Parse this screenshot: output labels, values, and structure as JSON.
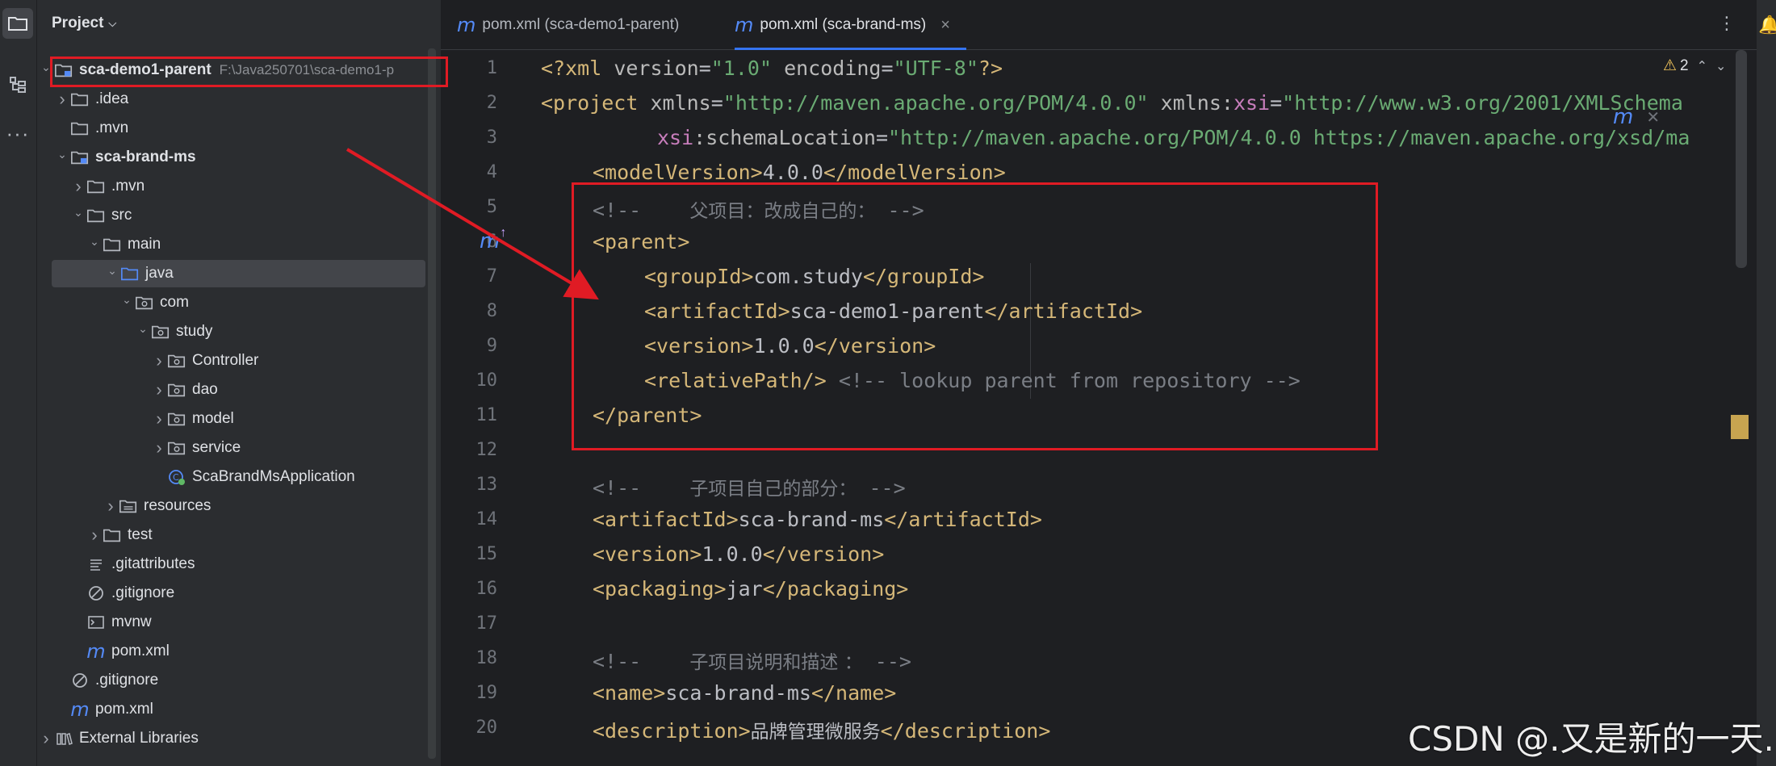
{
  "project_panel": {
    "title": "Project",
    "tree": [
      {
        "label": "sca-demo1-parent",
        "path": "F:\\Java250701\\sca-demo1-p",
        "icon": "module-folder-icon",
        "depth": 0,
        "chevron": "open",
        "bold": true
      },
      {
        "label": ".idea",
        "icon": "folder-icon",
        "depth": 1,
        "chevron": "closed"
      },
      {
        "label": ".mvn",
        "icon": "folder-icon",
        "depth": 1,
        "chevron": "none"
      },
      {
        "label": "sca-brand-ms",
        "icon": "module-folder-icon",
        "depth": 1,
        "chevron": "open",
        "bold": true
      },
      {
        "label": ".mvn",
        "icon": "folder-icon",
        "depth": 2,
        "chevron": "closed"
      },
      {
        "label": "src",
        "icon": "folder-icon",
        "depth": 2,
        "chevron": "open"
      },
      {
        "label": "main",
        "icon": "folder-icon",
        "depth": 3,
        "chevron": "open"
      },
      {
        "label": "java",
        "icon": "source-folder-icon",
        "depth": 4,
        "chevron": "open",
        "selected": true
      },
      {
        "label": "com",
        "icon": "package-icon",
        "depth": 5,
        "chevron": "open"
      },
      {
        "label": "study",
        "icon": "package-icon",
        "depth": 6,
        "chevron": "open"
      },
      {
        "label": "Controller",
        "icon": "package-icon",
        "depth": 7,
        "chevron": "closed"
      },
      {
        "label": "dao",
        "icon": "package-icon",
        "depth": 7,
        "chevron": "closed"
      },
      {
        "label": "model",
        "icon": "package-icon",
        "depth": 7,
        "chevron": "closed"
      },
      {
        "label": "service",
        "icon": "package-icon",
        "depth": 7,
        "chevron": "closed"
      },
      {
        "label": "ScaBrandMsApplication",
        "icon": "spring-class-icon",
        "depth": 7,
        "chevron": "none"
      },
      {
        "label": "resources",
        "icon": "resources-folder-icon",
        "depth": 4,
        "chevron": "closed"
      },
      {
        "label": "test",
        "icon": "folder-icon",
        "depth": 3,
        "chevron": "closed"
      },
      {
        "label": ".gitattributes",
        "icon": "text-file-icon",
        "depth": 2,
        "chevron": "none"
      },
      {
        "label": ".gitignore",
        "icon": "ignore-file-icon",
        "depth": 2,
        "chevron": "none"
      },
      {
        "label": "mvnw",
        "icon": "terminal-file-icon",
        "depth": 2,
        "chevron": "none"
      },
      {
        "label": "pom.xml",
        "icon": "maven-icon",
        "depth": 2,
        "chevron": "none"
      },
      {
        "label": ".gitignore",
        "icon": "ignore-file-icon",
        "depth": 1,
        "chevron": "none"
      },
      {
        "label": "pom.xml",
        "icon": "maven-icon",
        "depth": 1,
        "chevron": "none"
      },
      {
        "label": "External Libraries",
        "icon": "library-icon",
        "depth": 0,
        "chevron": "closed"
      }
    ]
  },
  "tabs": [
    {
      "label": "pom.xml (sca-demo1-parent)",
      "active": false
    },
    {
      "label": "pom.xml (sca-brand-ms)",
      "active": true,
      "close": "×"
    }
  ],
  "editor": {
    "warnings_count": "2",
    "line_numbers": [
      "1",
      "2",
      "3",
      "4",
      "5",
      "6",
      "7",
      "8",
      "9",
      "10",
      "11",
      "12",
      "13",
      "14",
      "15",
      "16",
      "17",
      "18",
      "19",
      "20"
    ],
    "lines": {
      "l1": {
        "open": "<?",
        "tag": "xml",
        "a1": " version",
        "eq1": "=",
        "s1": "\"1.0\"",
        "a2": " encoding",
        "eq2": "=",
        "s2": "\"UTF-8\"",
        "close": "?>"
      },
      "l2": {
        "tag": "<project",
        "a1": " xmlns",
        "eq1": "=",
        "s1": "\"http://maven.apache.org/POM/4.0.0\"",
        "a2": " xmlns:",
        "ns": "xsi",
        "eq2": "=",
        "s2": "\"http://www.w3.org/2001/XMLSchema"
      },
      "l3": {
        "ns": "xsi",
        "a": ":schemaLocation",
        "eq": "=",
        "s": "\"http://maven.apache.org/POM/4.0.0 https://maven.apache.org/xsd/ma"
      },
      "l4": {
        "open": "<modelVersion>",
        "value": "4.0.0",
        "close": "</modelVersion>"
      },
      "l5": {
        "c1": "<!--    ",
        "zh": "父项目：改成自己的：",
        "c2": " -->"
      },
      "l6": {
        "tag": "<parent>"
      },
      "l7": {
        "open": "<groupId>",
        "value": "com.study",
        "close": "</groupId>"
      },
      "l8": {
        "open": "<artifactId>",
        "value": "sca-demo1-parent",
        "close": "</artifactId>"
      },
      "l9": {
        "open": "<version>",
        "value": "1.0.0",
        "close": "</version>"
      },
      "l10": {
        "tag": "<relativePath/>",
        "comment": " <!-- lookup parent from repository -->"
      },
      "l11": {
        "tag": "</parent>"
      },
      "l13": {
        "c1": "<!--    ",
        "zh": "子项目自己的部分：",
        "c2": " -->"
      },
      "l14": {
        "open": "<artifactId>",
        "value": "sca-brand-ms",
        "close": "</artifactId>"
      },
      "l15": {
        "open": "<version>",
        "value": "1.0.0",
        "close": "</version>"
      },
      "l16": {
        "open": "<packaging>",
        "value": "jar",
        "close": "</packaging>"
      },
      "l18": {
        "c1": "<!--    ",
        "zh": "子项目说明和描述 ：",
        "c2": " -->"
      },
      "l19": {
        "open": "<name>",
        "value": "sca-brand-ms",
        "close": "</name>"
      },
      "l20": {
        "open": "<description>",
        "value": "品牌管理微服务",
        "close": "</description>"
      }
    }
  },
  "watermark": "CSDN @.又是新的一天.",
  "colors": {
    "annotation_red": "#e01b24",
    "accent_blue": "#3574f0",
    "maven_blue": "#548af7"
  }
}
